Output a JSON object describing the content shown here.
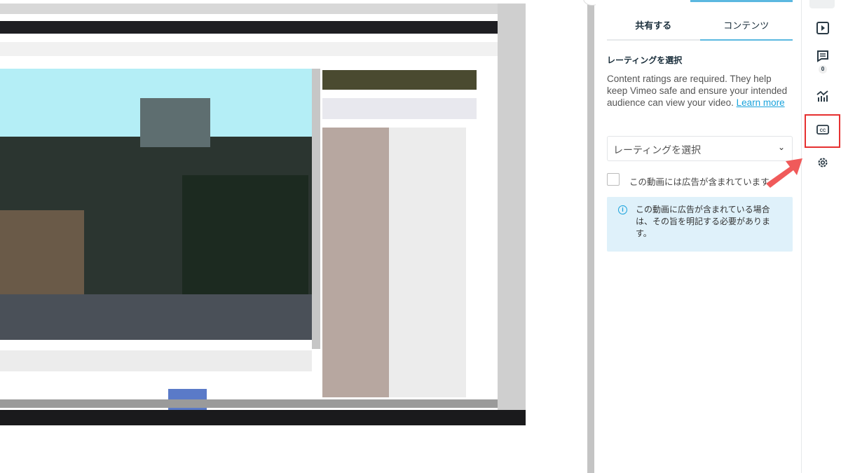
{
  "panel": {
    "tabs": [
      {
        "label": "共有する",
        "active": false
      },
      {
        "label": "コンテンツ",
        "active": true
      }
    ],
    "rating_heading": "レーティングを選択",
    "rating_description": "Content ratings are required. They help keep Vimeo safe and ensure your intended audience can view your video.",
    "learn_more": "Learn more",
    "rating_select": {
      "placeholder": "レーティングを選択"
    },
    "ads_checkbox": {
      "label": "この動画には広告が含まれています",
      "checked": false
    },
    "info_notice": "この動画に広告が含まれている場合は、その旨を明記する必要があります。"
  },
  "rail": {
    "items": [
      {
        "icon": "play-icon"
      },
      {
        "icon": "comment-icon",
        "badge": "0"
      },
      {
        "icon": "analytics-icon"
      },
      {
        "icon": "closed-captions-icon",
        "highlighted": true
      },
      {
        "icon": "gear-icon"
      }
    ]
  },
  "colors": {
    "accent": "#5bb8e0",
    "highlight": "#e63030",
    "arrow": "#f05a5a",
    "info_bg": "#dff1fa"
  }
}
